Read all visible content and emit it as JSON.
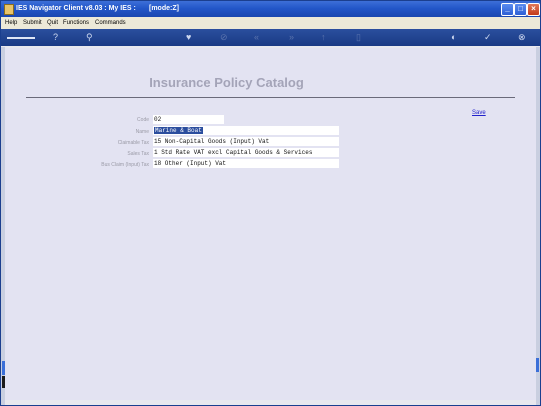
{
  "window": {
    "title": "IES Navigator Client v8.03 : My IES :",
    "mode": "[mode:Z]"
  },
  "menu": [
    "Help",
    "Submit",
    "Quit",
    "Functions",
    "Commands"
  ],
  "page": {
    "title": "Insurance Policy Catalog",
    "save_label": "Save"
  },
  "form": {
    "code_label": "Code",
    "code_value": "02",
    "name_label": "Name",
    "name_value": "Marine & Boat",
    "claimable_tax_label": "Claimable Tax",
    "claimable_tax_value": "15 Non-Capital Goods (Input) Vat",
    "sales_tax_label": "Sales Tax",
    "sales_tax_value": "1 Std Rate VAT excl Capital Goods & Services",
    "bus_claim_tax_label": "Bus Claim (Input) Tax",
    "bus_claim_tax_value": "18 Other (Input) Vat"
  }
}
